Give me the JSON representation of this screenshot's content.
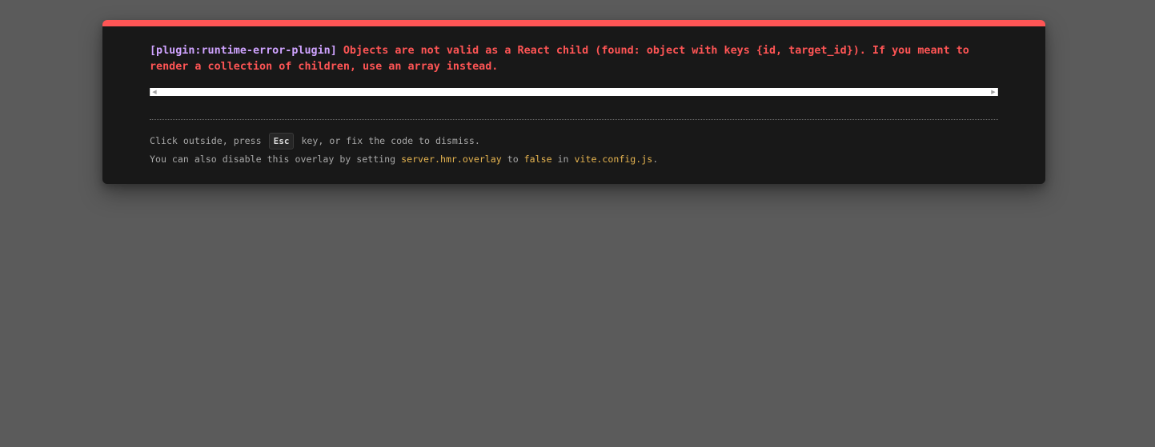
{
  "overlay": {
    "plugin_tag": "[plugin:runtime-error-plugin]",
    "message": "Objects are not valid as a React child (found: object with keys {id, target_id}). If you meant to render a collection of children, use an array instead.",
    "tip_line1": {
      "before": "Click outside, press ",
      "key": "Esc",
      "after": " key, or fix the code to dismiss."
    },
    "tip_line2": {
      "part1": "You can also disable this overlay by setting ",
      "code1": "server.hmr.overlay",
      "part2": " to ",
      "code2": "false",
      "part3": " in ",
      "code3": "vite.config.js",
      "part4": "."
    },
    "scroll_left_icon": "◀",
    "scroll_right_icon": "▶"
  },
  "colors": {
    "background": "#5b5b5b",
    "panel": "#181818",
    "accent_red": "#ff5555",
    "plugin_purple": "#cfa3ff",
    "code_yellow": "#e6b450",
    "tip_text": "#a8a8a8"
  }
}
